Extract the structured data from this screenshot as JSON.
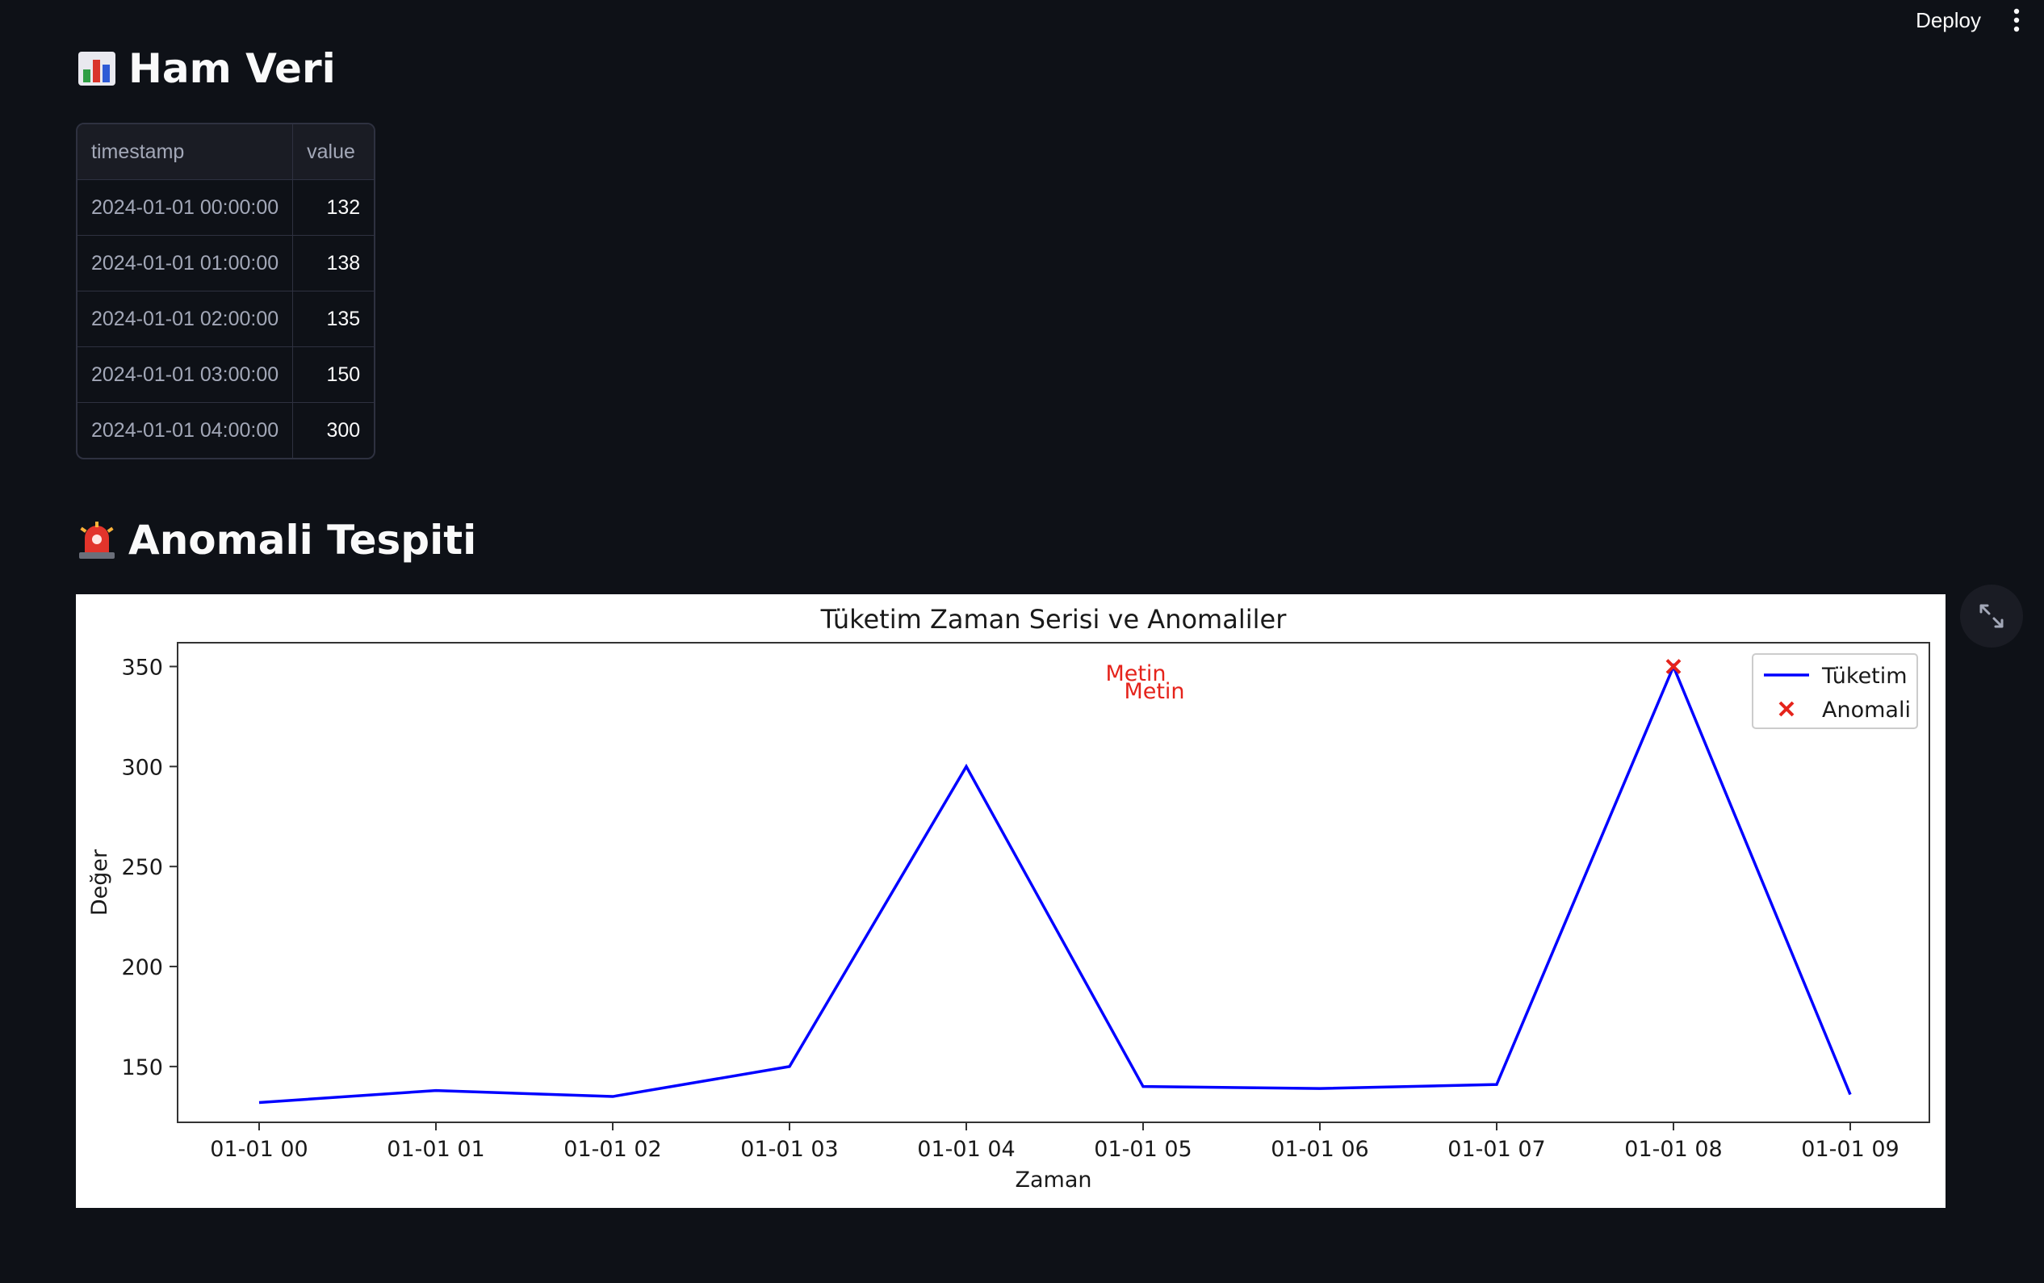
{
  "header": {
    "deploy_label": "Deploy",
    "menu_icon": "kebab-menu-icon"
  },
  "section1": {
    "icon": "bar-chart-icon",
    "title": "Ham Veri"
  },
  "dataframe": {
    "columns": [
      "timestamp",
      "value"
    ],
    "rows": [
      {
        "timestamp": "2024-01-01 00:00:00",
        "value": "132"
      },
      {
        "timestamp": "2024-01-01 01:00:00",
        "value": "138"
      },
      {
        "timestamp": "2024-01-01 02:00:00",
        "value": "135"
      },
      {
        "timestamp": "2024-01-01 03:00:00",
        "value": "150"
      },
      {
        "timestamp": "2024-01-01 04:00:00",
        "value": "300"
      }
    ]
  },
  "section2": {
    "icon": "siren-icon",
    "title": "Anomali Tespiti"
  },
  "chart_data": {
    "type": "line",
    "title": "Tüketim Zaman Serisi ve Anomaliler",
    "xlabel": "Zaman",
    "ylabel": "Değer",
    "x": [
      "01-01 00",
      "01-01 01",
      "01-01 02",
      "01-01 03",
      "01-01 04",
      "01-01 05",
      "01-01 06",
      "01-01 07",
      "01-01 08",
      "01-01 09"
    ],
    "yticks": [
      150,
      200,
      250,
      300,
      350
    ],
    "ylim": [
      122.1,
      361.9
    ],
    "series": [
      {
        "name": "Tüketim",
        "color": "#0000ff",
        "type": "line",
        "values": [
          132,
          138,
          135,
          150,
          300,
          140,
          139,
          141,
          350,
          136
        ]
      },
      {
        "name": "Anomali",
        "color": "#e5231b",
        "type": "scatter",
        "marker": "x",
        "points": [
          {
            "x": "01-01 08",
            "y": 350
          }
        ]
      }
    ],
    "annotations": [
      {
        "text": "Metin",
        "x": "01-01 05",
        "y": 347,
        "color": "#e5231b"
      },
      {
        "text": "Metin",
        "x": "01-01 05",
        "y": 338,
        "color": "#e5231b"
      }
    ],
    "legend": "top-right",
    "grid": false
  },
  "fullscreen": {
    "icon": "fullscreen-expand-icon"
  }
}
